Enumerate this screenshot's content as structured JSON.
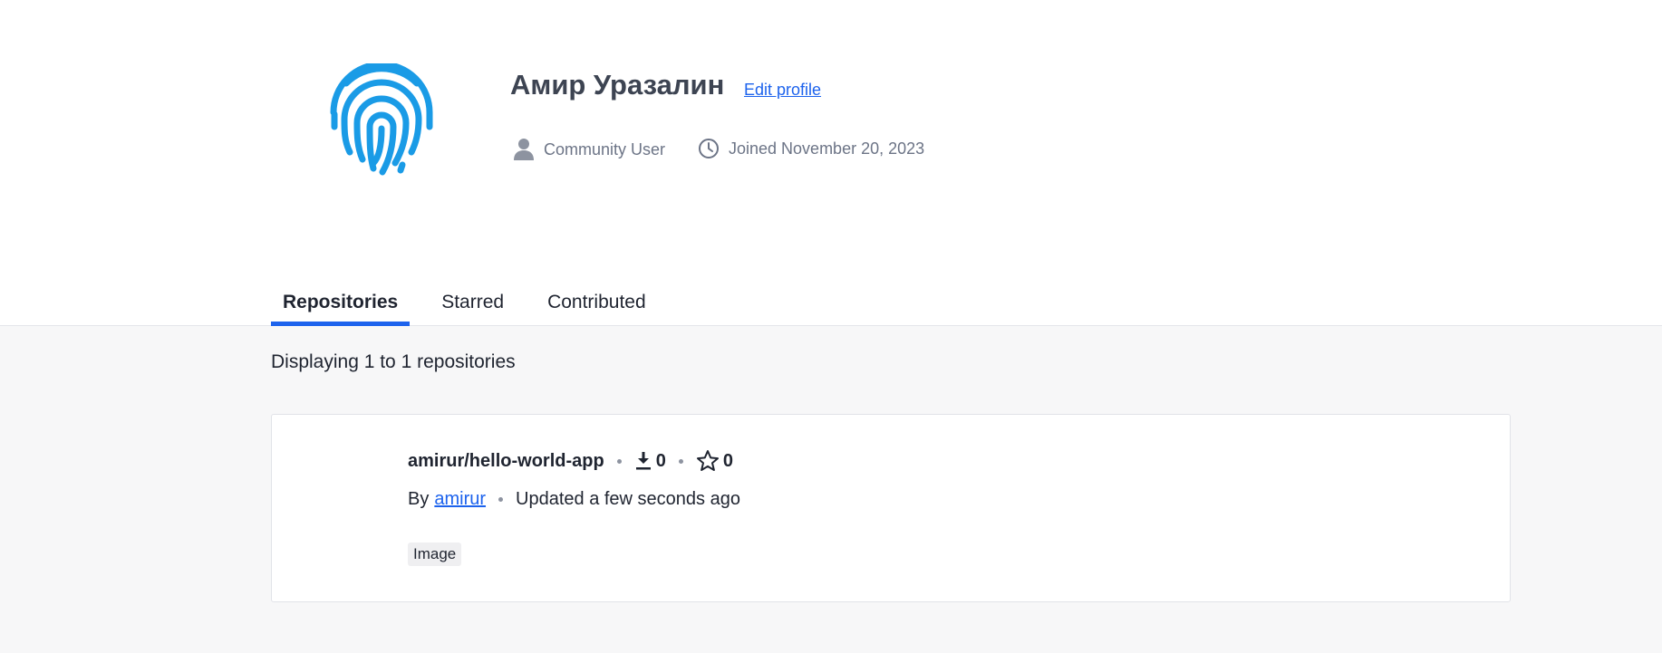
{
  "profile": {
    "name": "Амир Уразалин",
    "edit_label": "Edit profile",
    "role": "Community User",
    "joined": "Joined November 20, 2023",
    "avatar_icon": "fingerprint-icon",
    "avatar_color": "#1a9be6"
  },
  "tabs": [
    {
      "label": "Repositories",
      "active": true
    },
    {
      "label": "Starred",
      "active": false
    },
    {
      "label": "Contributed",
      "active": false
    }
  ],
  "repositories": {
    "summary": "Displaying 1 to 1 repositories",
    "items": [
      {
        "name": "amirur/hello-world-app",
        "downloads": "0",
        "stars": "0",
        "by_label": "By",
        "author": "amirur",
        "updated": "Updated a few seconds ago",
        "tag": "Image"
      }
    ]
  },
  "colors": {
    "accent": "#1d63ed",
    "text": "#1f2430",
    "muted": "#6c7486"
  }
}
